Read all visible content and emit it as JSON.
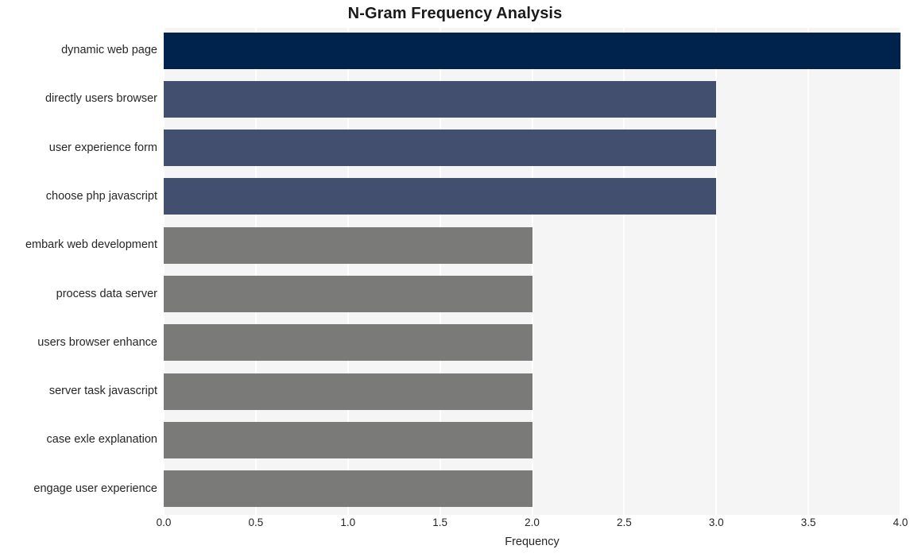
{
  "chart_data": {
    "type": "bar",
    "orientation": "horizontal",
    "title": "N-Gram Frequency Analysis",
    "xlabel": "Frequency",
    "ylabel": "",
    "categories": [
      "dynamic web page",
      "directly users browser",
      "user experience form",
      "choose php javascript",
      "embark web development",
      "process data server",
      "users browser enhance",
      "server task javascript",
      "case exle explanation",
      "engage user experience"
    ],
    "values": [
      4,
      3,
      3,
      3,
      2,
      2,
      2,
      2,
      2,
      2
    ],
    "bar_colors": [
      "#00234d",
      "#434f6f",
      "#434f6f",
      "#434f6f",
      "#7a7a79",
      "#7a7a79",
      "#7a7a79",
      "#7a7a79",
      "#7a7a79",
      "#7a7a79"
    ],
    "xlim": [
      0,
      4
    ],
    "xticks": [
      "0.0",
      "0.5",
      "1.0",
      "1.5",
      "2.0",
      "2.5",
      "3.0",
      "3.5",
      "4.0"
    ],
    "xtick_values": [
      0,
      0.5,
      1,
      1.5,
      2,
      2.5,
      3,
      3.5,
      4
    ],
    "grid": true,
    "grid_axis": "x",
    "legend": false,
    "plot_background": "#f5f5f6",
    "gridline_color": "#ffffff",
    "figure_background": "#ffffff"
  }
}
